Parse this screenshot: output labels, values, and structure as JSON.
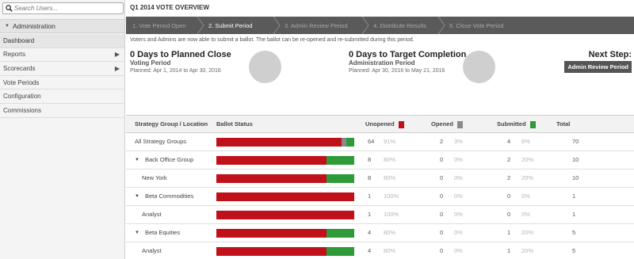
{
  "search": {
    "placeholder": "Search Users..."
  },
  "sidebar": {
    "section_label": "Administration",
    "items": [
      {
        "label": "Dashboard",
        "has_submenu": false,
        "active": true
      },
      {
        "label": "Reports",
        "has_submenu": true,
        "active": false
      },
      {
        "label": "Scorecards",
        "has_submenu": true,
        "active": false
      },
      {
        "label": "Vote Periods",
        "has_submenu": false,
        "active": false
      },
      {
        "label": "Configuration",
        "has_submenu": false,
        "active": false
      },
      {
        "label": "Commissions",
        "has_submenu": false,
        "active": false
      }
    ]
  },
  "page_title": "Q1 2014 VOTE OVERVIEW",
  "steps": [
    {
      "label": "1. Vote Period Open",
      "active": false
    },
    {
      "label": "2. Submit Period",
      "active": true
    },
    {
      "label": "3. Admin Review Period",
      "active": false
    },
    {
      "label": "4. Distribute Results",
      "active": false
    },
    {
      "label": "5. Close Vote Period",
      "active": false
    }
  ],
  "info_text": "Voters and Admins are now able to submit a ballot. The ballot can be re-opened and re-submitted during this period.",
  "voting_card": {
    "headline": "0 Days to Planned Close",
    "subtitle": "Voting Period",
    "planned": "Planned: Apr 1, 2014 to Apr 30, 2016"
  },
  "admin_card": {
    "headline": "0 Days to Target Completion",
    "subtitle": "Administration Period",
    "planned": "Planned: Apr 30, 2016 to May 21, 2016"
  },
  "next_step": {
    "label": "Next Step:",
    "button": "Admin Review Period"
  },
  "table": {
    "headers": {
      "group": "Strategy Group / Location",
      "status": "Ballot Status",
      "unopened": "Unopened",
      "opened": "Opened",
      "submitted": "Submitted",
      "total": "Total"
    },
    "colors": {
      "unopened": "#c0111b",
      "opened": "#8a8a8a",
      "submitted": "#2e9a38"
    },
    "rows": [
      {
        "name": "All Strategy Groups",
        "expander": false,
        "indent": false,
        "unopened": "64",
        "unopened_pct": "91%",
        "opened": "2",
        "opened_pct": "3%",
        "submitted": "4",
        "submitted_pct": "6%",
        "total": "70",
        "fractions": [
          0.91,
          0.03,
          0.06
        ]
      },
      {
        "name": "Back Office Group",
        "expander": true,
        "indent": false,
        "unopened": "8",
        "unopened_pct": "80%",
        "opened": "0",
        "opened_pct": "0%",
        "submitted": "2",
        "submitted_pct": "20%",
        "total": "10",
        "fractions": [
          0.8,
          0.0,
          0.2
        ]
      },
      {
        "name": "New York",
        "expander": false,
        "indent": true,
        "unopened": "8",
        "unopened_pct": "80%",
        "opened": "0",
        "opened_pct": "0%",
        "submitted": "2",
        "submitted_pct": "20%",
        "total": "10",
        "fractions": [
          0.8,
          0.0,
          0.2
        ]
      },
      {
        "name": "Beta Commodities",
        "expander": true,
        "indent": false,
        "unopened": "1",
        "unopened_pct": "100%",
        "opened": "0",
        "opened_pct": "0%",
        "submitted": "0",
        "submitted_pct": "0%",
        "total": "1",
        "fractions": [
          1.0,
          0.0,
          0.0
        ]
      },
      {
        "name": "Analyst",
        "expander": false,
        "indent": true,
        "unopened": "1",
        "unopened_pct": "100%",
        "opened": "0",
        "opened_pct": "0%",
        "submitted": "0",
        "submitted_pct": "0%",
        "total": "1",
        "fractions": [
          1.0,
          0.0,
          0.0
        ]
      },
      {
        "name": "Beta Equities",
        "expander": true,
        "indent": false,
        "unopened": "4",
        "unopened_pct": "80%",
        "opened": "0",
        "opened_pct": "0%",
        "submitted": "1",
        "submitted_pct": "20%",
        "total": "5",
        "fractions": [
          0.8,
          0.0,
          0.2
        ]
      },
      {
        "name": "Analyst",
        "expander": false,
        "indent": true,
        "unopened": "4",
        "unopened_pct": "80%",
        "opened": "0",
        "opened_pct": "0%",
        "submitted": "1",
        "submitted_pct": "20%",
        "total": "5",
        "fractions": [
          0.8,
          0.0,
          0.2
        ]
      }
    ]
  }
}
